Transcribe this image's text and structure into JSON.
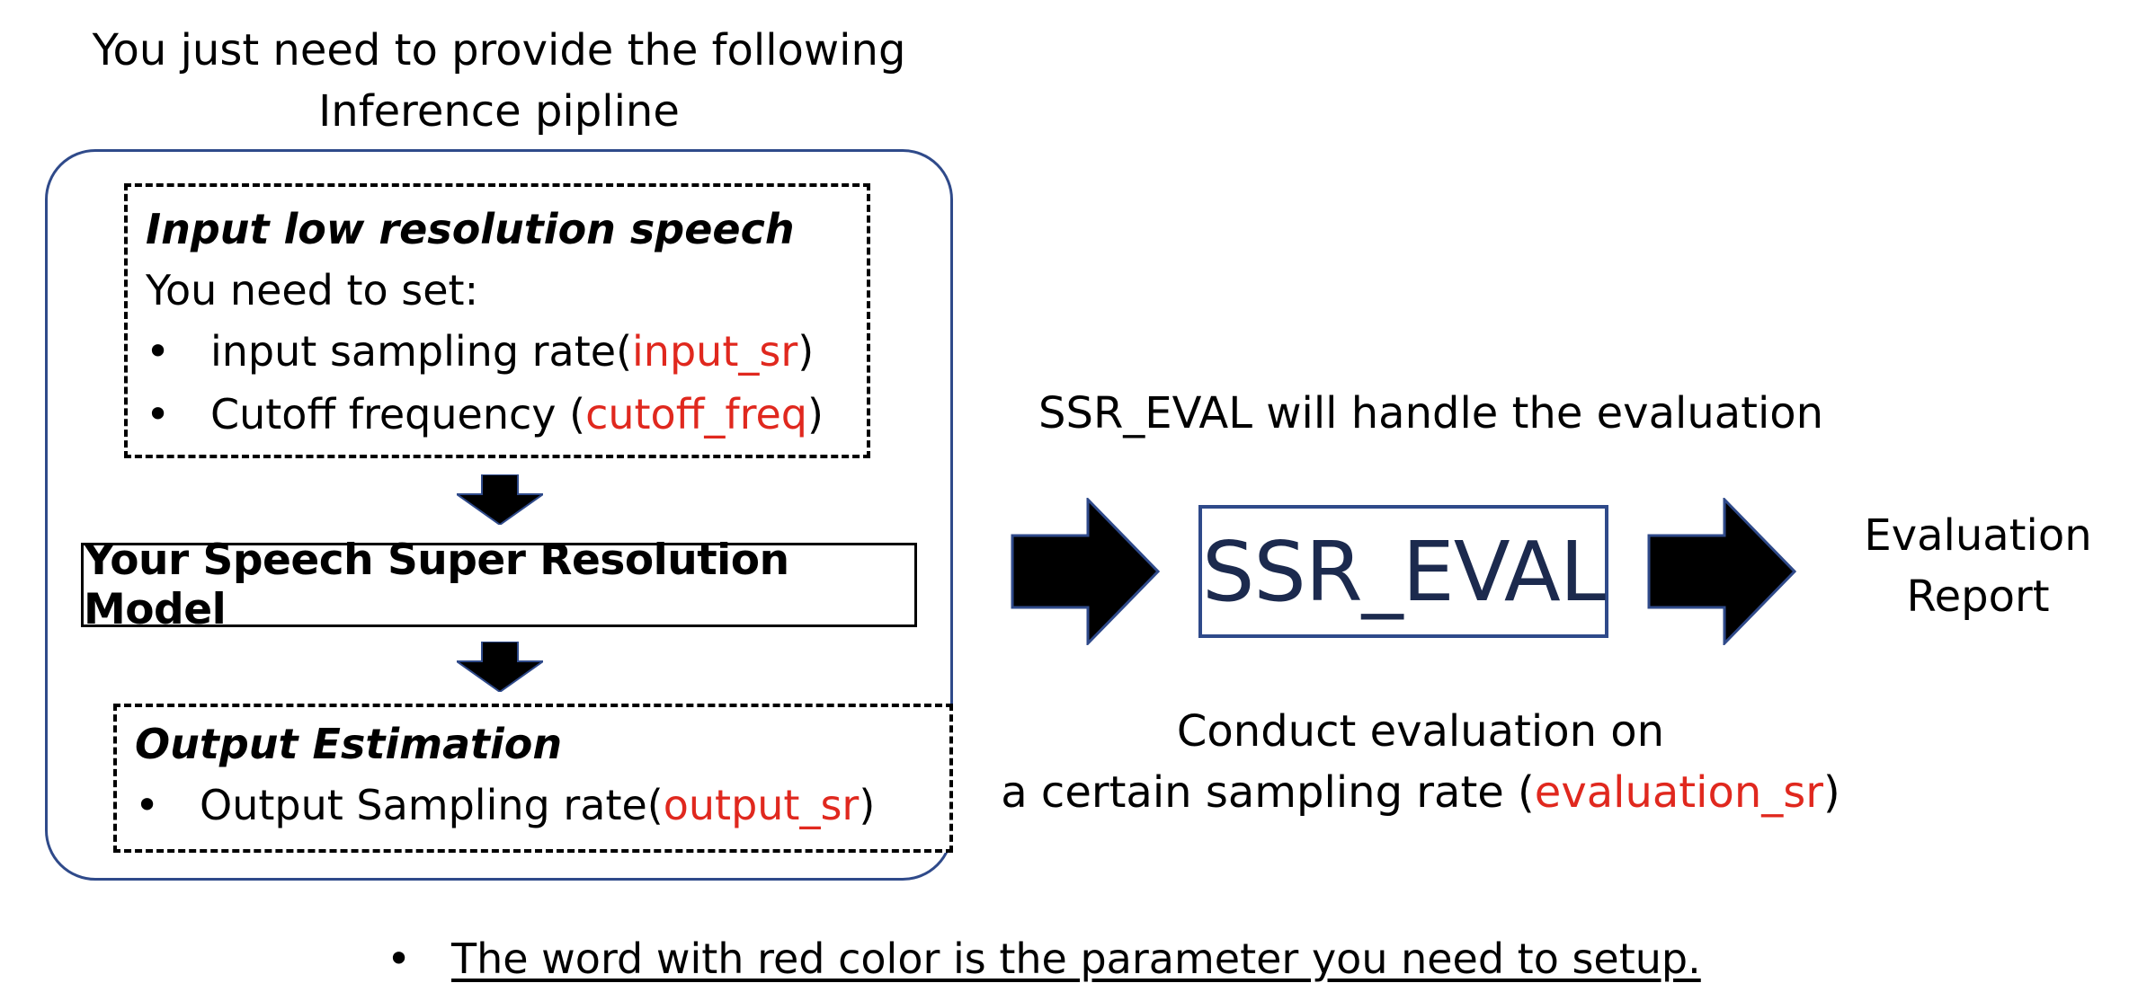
{
  "header": {
    "line1": "You just need to provide the following",
    "line2": "Inference pipline"
  },
  "input_box": {
    "title": "Input low resolution speech",
    "subtitle": "You need to set:",
    "items": [
      {
        "text": "input sampling rate(",
        "param": "input_sr",
        "suffix": ")"
      },
      {
        "text": "Cutoff frequency (",
        "param": "cutoff_freq",
        "suffix": ")"
      }
    ]
  },
  "model": {
    "label": "Your Speech Super Resolution Model"
  },
  "output_box": {
    "title": "Output Estimation",
    "items": [
      {
        "text": "Output Sampling rate(",
        "param": "output_sr",
        "suffix": ")"
      }
    ]
  },
  "ssr_eval": {
    "caption": "SSR_EVAL will handle the evaluation",
    "label": "SSR_EVAL",
    "note_line1": "Conduct evaluation on",
    "note_line2_prefix": "a certain sampling rate (",
    "note_param": "evaluation_sr",
    "note_line2_suffix": ")"
  },
  "report": {
    "line1": "Evaluation",
    "line2": "Report"
  },
  "footer": {
    "bullet": "•",
    "text": "The word with red color is the parameter you need to setup."
  },
  "bullet_symbol": "•",
  "colors": {
    "param": "#e0281e",
    "box_border": "#2f4a8a",
    "arrow": "#000000"
  }
}
